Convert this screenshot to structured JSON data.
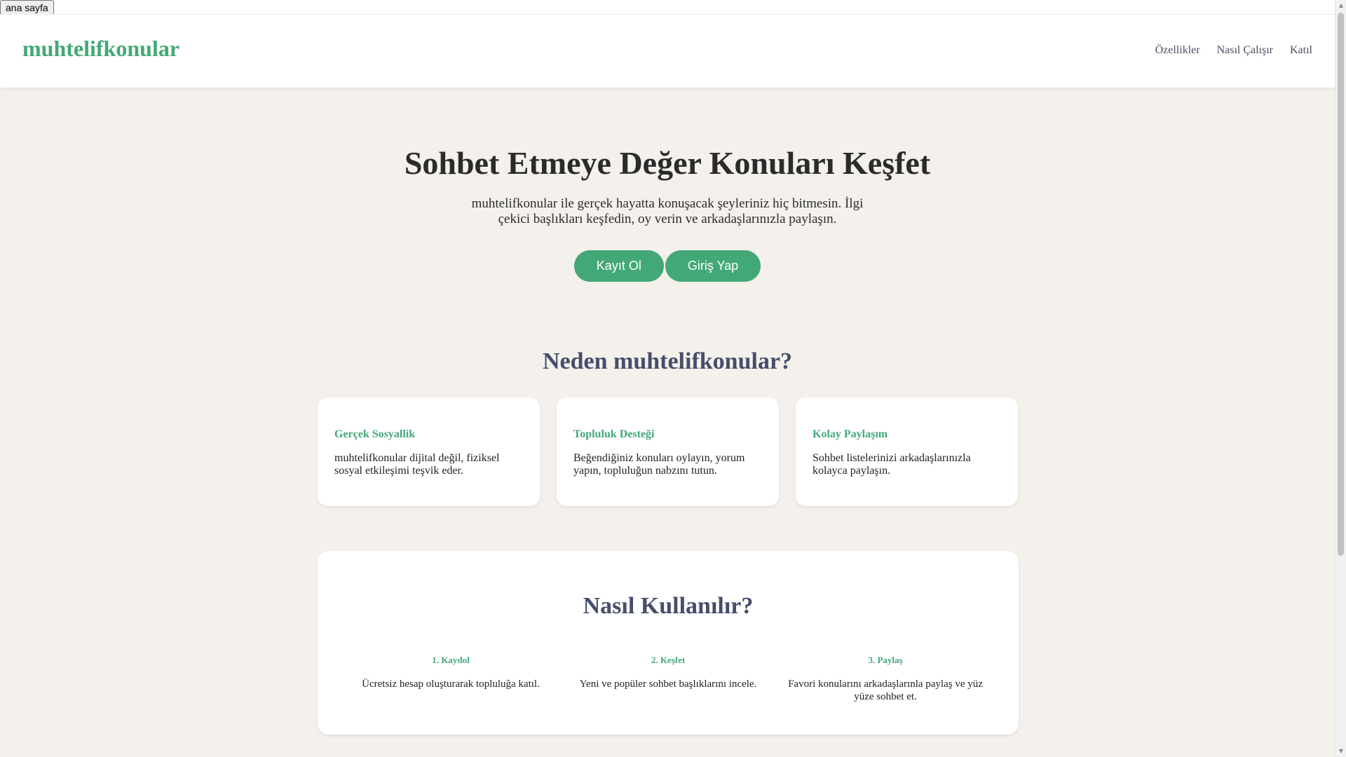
{
  "top": {
    "home_button": "ana sayfa"
  },
  "header": {
    "logo": "muhtelifkonular",
    "nav": [
      "Özellikler",
      "Nasıl Çalışır",
      "Katıl"
    ]
  },
  "hero": {
    "title": "Sohbet Etmeye Değer Konuları Keşfet",
    "subtitle": "muhtelifkonular ile gerçek hayatta konuşacak şeyleriniz hiç bitmesin. İlgi çekici başlıkları keşfedin, oy verin ve arkadaşlarınızla paylaşın.",
    "signup_label": "Kayıt Ol",
    "login_label": "Giriş Yap"
  },
  "features": {
    "title": "Neden muhtelifkonular?",
    "cards": [
      {
        "title": "Gerçek Sosyallik",
        "text": "muhtelifkonular dijital değil, fiziksel sosyal etkileşimi teşvik eder."
      },
      {
        "title": "Topluluk Desteği",
        "text": "Beğendiğiniz konuları oylayın, yorum yapın, topluluğun nabzını tutun."
      },
      {
        "title": "Kolay Paylaşım",
        "text": "Sohbet listelerinizi arkadaşlarınızla kolayca paylaşın."
      }
    ]
  },
  "howto": {
    "title": "Nasıl Kullanılır?",
    "steps": [
      {
        "title": "1. Kaydol",
        "text": "Ücretsiz hesap oluşturarak topluluğa katıl."
      },
      {
        "title": "2. Keşfet",
        "text": "Yeni ve popüler sohbet başlıklarını incele."
      },
      {
        "title": "3. Paylaş",
        "text": "Favori konularını arkadaşlarınla paylaş ve yüz yüze sohbet et."
      }
    ]
  },
  "colors": {
    "accent": "#43a877",
    "heading": "#464e6b",
    "background": "#f4f1ec"
  },
  "icons": {
    "scroll_up": "scroll-up-arrow-icon",
    "scroll_down": "scroll-down-arrow-icon"
  }
}
